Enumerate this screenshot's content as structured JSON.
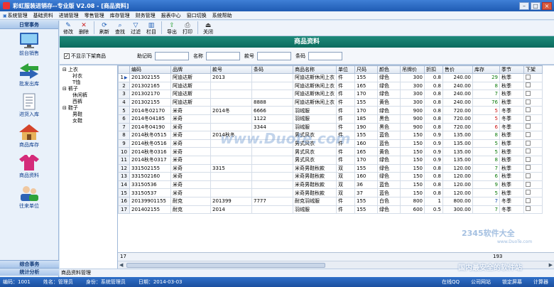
{
  "window": {
    "title": "彩虹服装进销存--专业版 V2.08 - [商品资料]"
  },
  "menu": [
    "系统管理",
    "基础资料",
    "进销管理",
    "零售管理",
    "库存管理",
    "财务管理",
    "报表中心",
    "窗口切换",
    "系统帮助"
  ],
  "sidebar": {
    "header": "日常事务",
    "items": [
      {
        "label": "前台销售",
        "icon": "monitor-icon"
      },
      {
        "label": "批发出库",
        "icon": "arrows-icon"
      },
      {
        "label": "进货入库",
        "icon": "document-icon"
      },
      {
        "label": "商品库存",
        "icon": "house-icon"
      },
      {
        "label": "商品资料",
        "icon": "shirt-icon"
      },
      {
        "label": "往来单位",
        "icon": "people-icon"
      }
    ],
    "footer1": "综合事务",
    "footer2": "统计分析"
  },
  "toolbar": [
    {
      "label": "修改",
      "icon": "edit-icon"
    },
    {
      "label": "删除",
      "icon": "delete-icon"
    },
    {
      "label": "刷新",
      "icon": "refresh-icon"
    },
    {
      "label": "查找",
      "icon": "find-icon"
    },
    {
      "label": "过滤",
      "icon": "filter-icon"
    },
    {
      "label": "栏目",
      "icon": "columns-icon"
    },
    {
      "label": "导出",
      "icon": "export-icon"
    },
    {
      "label": "打印",
      "icon": "print-icon"
    },
    {
      "label": "关闭",
      "icon": "close-icon"
    }
  ],
  "banner": "商品资料",
  "filter": {
    "hide_label": "不显示下架商品",
    "hide_checked": true,
    "zhujima": "助记码",
    "name": "名称",
    "kuanhao": "款号",
    "tiaoma": "条码"
  },
  "tree": [
    {
      "label": "上衣",
      "level": 0
    },
    {
      "label": "衬衣",
      "level": 1
    },
    {
      "label": "T恤",
      "level": 1
    },
    {
      "label": "裤子",
      "level": 0
    },
    {
      "label": "休闲裤",
      "level": 1
    },
    {
      "label": "西裤",
      "level": 1
    },
    {
      "label": "鞋子",
      "level": 0
    },
    {
      "label": "男鞋",
      "level": 1
    },
    {
      "label": "女鞋",
      "level": 1
    }
  ],
  "grid": {
    "columns": [
      "编码",
      "品牌",
      "款号",
      "条码",
      "商品名称",
      "单位",
      "尺码",
      "颜色",
      "吊牌价",
      "折扣",
      "售价",
      "库存",
      "季节",
      "下架"
    ],
    "rows": [
      [
        "201302155",
        "阿迪达斯",
        "2013",
        "",
        "阿迪达斯休闲上衣",
        "件",
        "155",
        "绿色",
        "300",
        "0.8",
        "240.00",
        "29",
        "秋季",
        "green"
      ],
      [
        "201302165",
        "阿迪达斯",
        "",
        "",
        "阿迪达斯休闲上衣",
        "件",
        "165",
        "绿色",
        "300",
        "0.8",
        "240.00",
        "8",
        "秋季",
        "green"
      ],
      [
        "201302170",
        "阿迪达斯",
        "",
        "",
        "阿迪达斯休闲上衣",
        "件",
        "170",
        "绿色",
        "300",
        "0.8",
        "240.00",
        "7",
        "秋季",
        "green"
      ],
      [
        "201302155",
        "阿迪达斯",
        "",
        "8888",
        "阿迪达斯休闲上衣",
        "件",
        "155",
        "黄色",
        "300",
        "0.8",
        "240.00",
        "76",
        "秋季",
        "green"
      ],
      [
        "2014冬02170",
        "米奇",
        "2014冬",
        "6666",
        "羽绒服",
        "件",
        "170",
        "绿色",
        "900",
        "0.8",
        "720.00",
        "5",
        "冬季",
        "red"
      ],
      [
        "2014冬04185",
        "米奇",
        "",
        "1122",
        "羽绒服",
        "件",
        "185",
        "黑色",
        "900",
        "0.8",
        "720.00",
        "5",
        "冬季",
        "red"
      ],
      [
        "2014冬04190",
        "米奇",
        "",
        "3344",
        "羽绒服",
        "件",
        "190",
        "黑色",
        "900",
        "0.8",
        "720.00",
        "6",
        "冬季",
        "red"
      ],
      [
        "2014秋冬0515",
        "米奇",
        "2014秋冬",
        "",
        "男式风衣",
        "件",
        "155",
        "蓝色",
        "150",
        "0.9",
        "135.00",
        "8",
        "秋季",
        "green"
      ],
      [
        "2014秋冬0516",
        "米奇",
        "",
        "",
        "男式风衣",
        "件",
        "160",
        "蓝色",
        "150",
        "0.9",
        "135.00",
        "5",
        "秋季",
        "green"
      ],
      [
        "2014秋冬0316",
        "米奇",
        "",
        "",
        "男式风衣",
        "件",
        "165",
        "黄色",
        "150",
        "0.9",
        "135.00",
        "5",
        "秋季",
        "green"
      ],
      [
        "2014秋冬0317",
        "米奇",
        "",
        "",
        "男式风衣",
        "件",
        "170",
        "绿色",
        "150",
        "0.9",
        "135.00",
        "8",
        "秋季",
        "green"
      ],
      [
        "331502155",
        "米奇",
        "3315",
        "",
        "米奇男鞋秋款",
        "双",
        "155",
        "绿色",
        "150",
        "0.8",
        "120.00",
        "7",
        "秋季",
        "green"
      ],
      [
        "331502160",
        "米奇",
        "",
        "",
        "米奇男鞋秋款",
        "双",
        "160",
        "绿色",
        "150",
        "0.8",
        "120.00",
        "6",
        "秋季",
        "green"
      ],
      [
        "33150536",
        "米奇",
        "",
        "",
        "米奇男鞋秋款",
        "双",
        "36",
        "蓝色",
        "150",
        "0.8",
        "120.00",
        "9",
        "秋季",
        "green"
      ],
      [
        "33150537",
        "米奇",
        "",
        "",
        "米奇男鞋秋款",
        "双",
        "37",
        "蓝色",
        "150",
        "0.8",
        "120.00",
        "5",
        "秋季",
        "green"
      ],
      [
        "20139901155",
        "耐克",
        "201399",
        "7777",
        "耐克羽绒服",
        "件",
        "155",
        "白色",
        "800",
        "1",
        "800.00",
        "7",
        "冬季",
        "blue"
      ],
      [
        "201402155",
        "耐克",
        "2014",
        "",
        "羽绒服",
        "件",
        "155",
        "绿色",
        "600",
        "0.5",
        "300.00",
        "7",
        "冬季",
        "green"
      ]
    ],
    "row_count": "17",
    "stock_total": "193"
  },
  "tab": "商品资料管理",
  "status": {
    "code_label": "编码：",
    "code": "1001",
    "name_label": "姓名：",
    "name": "管理员",
    "role_label": "身份：",
    "role": "系统管理员",
    "date_label": "日期：",
    "date": "2014-03-03",
    "right": [
      "在线QQ",
      "公司网站",
      "锁定屏幕",
      "计算器"
    ]
  },
  "watermarks": {
    "duote": "www.Duote.com",
    "soft": "2345软件大全",
    "soft_url": "www.DuoTe.com",
    "safest": "国内最安全的软件站"
  }
}
